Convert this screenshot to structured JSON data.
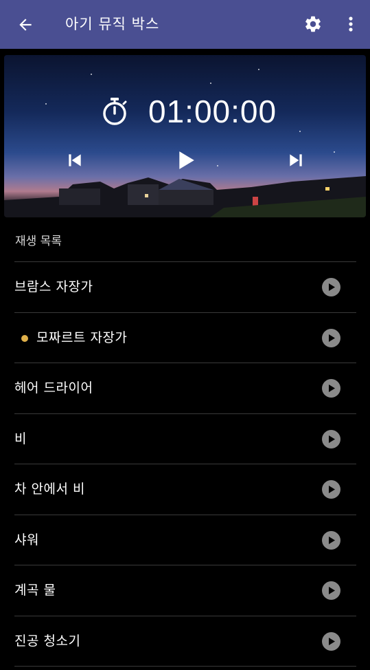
{
  "app": {
    "title": "아기 뮤직 박스"
  },
  "player": {
    "time": "01:00:00"
  },
  "playlist": {
    "heading": "재생 목록",
    "items": [
      {
        "label": "브람스 자장가",
        "playing": false
      },
      {
        "label": "모짜르트 자장가",
        "playing": true
      },
      {
        "label": "헤어 드라이어",
        "playing": false
      },
      {
        "label": "비",
        "playing": false
      },
      {
        "label": "차 안에서 비",
        "playing": false
      },
      {
        "label": "샤워",
        "playing": false
      },
      {
        "label": "계곡 물",
        "playing": false
      },
      {
        "label": "진공 청소기",
        "playing": false
      }
    ]
  },
  "colors": {
    "appbar": "#4a4f92",
    "background": "#000000",
    "now_playing_dot": "#e0b04a",
    "play_button": "#8a8a8a"
  },
  "icons": [
    "back-arrow-icon",
    "gear-icon",
    "more-vert-icon",
    "stopwatch-icon",
    "skip-previous-icon",
    "play-icon",
    "skip-next-icon"
  ]
}
